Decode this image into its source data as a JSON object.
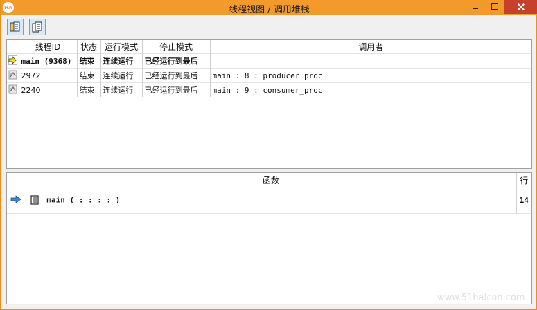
{
  "window": {
    "app_icon_text": "HA",
    "title": "线程视图 / 调用堆栈"
  },
  "toolbar": {
    "buttons": [
      {
        "name": "thread-view",
        "icon": "document-stack-icon"
      },
      {
        "name": "call-stack-view",
        "icon": "pages-icon"
      }
    ]
  },
  "threads": {
    "columns": [
      "",
      "线程ID",
      "状态",
      "运行模式",
      "停止模式",
      "调用者"
    ],
    "rows": [
      {
        "icon": "current-thread-arrow-icon",
        "id": "main (9368)",
        "state": "结束",
        "run_mode": "连续运行",
        "stop_mode": "已经运行到最后",
        "caller": "",
        "current": true
      },
      {
        "icon": "thread-icon",
        "id": "2972",
        "state": "结束",
        "run_mode": "连续运行",
        "stop_mode": "已经运行到最后",
        "caller": "main : 8 : producer_proc",
        "current": false
      },
      {
        "icon": "thread-icon",
        "id": "2240",
        "state": "结束",
        "run_mode": "连续运行",
        "stop_mode": "已经运行到最后",
        "caller": "main : 9 : consumer_proc",
        "current": false
      }
    ]
  },
  "callstack": {
    "columns": [
      "",
      "函数",
      "行"
    ],
    "rows": [
      {
        "icon": "blue-arrow-icon",
        "func_icon": "procedure-icon",
        "function": "main ( : : : : )",
        "line": "14"
      }
    ]
  },
  "watermark": "www.51halcon.com"
}
